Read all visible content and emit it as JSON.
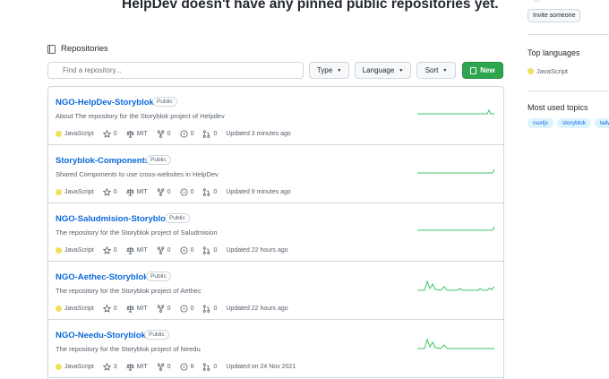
{
  "pinned_message": "HelpDev doesn't have any pinned public repositories yet.",
  "repositories_label": "Repositories",
  "search": {
    "placeholder": "Find a repository..."
  },
  "filters": {
    "type": "Type",
    "language": "Language",
    "sort": "Sort"
  },
  "new_button": "New",
  "repos": [
    {
      "name": "NGO-HelpDev-Storyblok",
      "visibility": "Public",
      "description": "About The repository for the Storyblok project of Helpdev",
      "language": "JavaScript",
      "stars": "0",
      "license": "MIT",
      "forks": "0",
      "issues": "0",
      "pulls": "0",
      "updated": "Updated 3 minutes ago"
    },
    {
      "name": "Storyblok-Components",
      "visibility": "Public",
      "description": "Shared Components to use cross-websites in HelpDev",
      "language": "JavaScript",
      "stars": "0",
      "license": "MIT",
      "forks": "0",
      "issues": "0",
      "pulls": "0",
      "updated": "Updated 9 minutes ago"
    },
    {
      "name": "NGO-Saludmision-Storyblok",
      "visibility": "Public",
      "description": "The repository for the Storyblok project of Saludmision",
      "language": "JavaScript",
      "stars": "0",
      "license": "MIT",
      "forks": "0",
      "issues": "0",
      "pulls": "0",
      "updated": "Updated 22 hours ago"
    },
    {
      "name": "NGO-Aethec-Storyblok",
      "visibility": "Public",
      "description": "The repository for the Storyblok project of Aethec",
      "language": "JavaScript",
      "stars": "0",
      "license": "MIT",
      "forks": "0",
      "issues": "0",
      "pulls": "0",
      "updated": "Updated 22 hours ago"
    },
    {
      "name": "NGO-Needu-Storyblok",
      "visibility": "Public",
      "description": "The repository for the Storyblok project of Needu",
      "language": "JavaScript",
      "stars": "3",
      "license": "MIT",
      "forks": "0",
      "issues": "8",
      "pulls": "0",
      "updated": "Updated on 24 Nov 2021"
    }
  ],
  "sidebar": {
    "invite_label": "Invite someone",
    "top_languages_title": "Top languages",
    "top_language": "JavaScript",
    "topics_title": "Most used topics",
    "topics": [
      "nuxtjs",
      "storyblok",
      "tailwindcss"
    ]
  },
  "colors": {
    "link": "#0969da",
    "new_button": "#2da44e",
    "javascript": "#f1e05a",
    "activity_graph": "#40c463"
  },
  "icons": [
    "repo-icon",
    "search-icon",
    "star-icon",
    "law-icon",
    "fork-icon",
    "issue-icon",
    "pull-request-icon"
  ]
}
